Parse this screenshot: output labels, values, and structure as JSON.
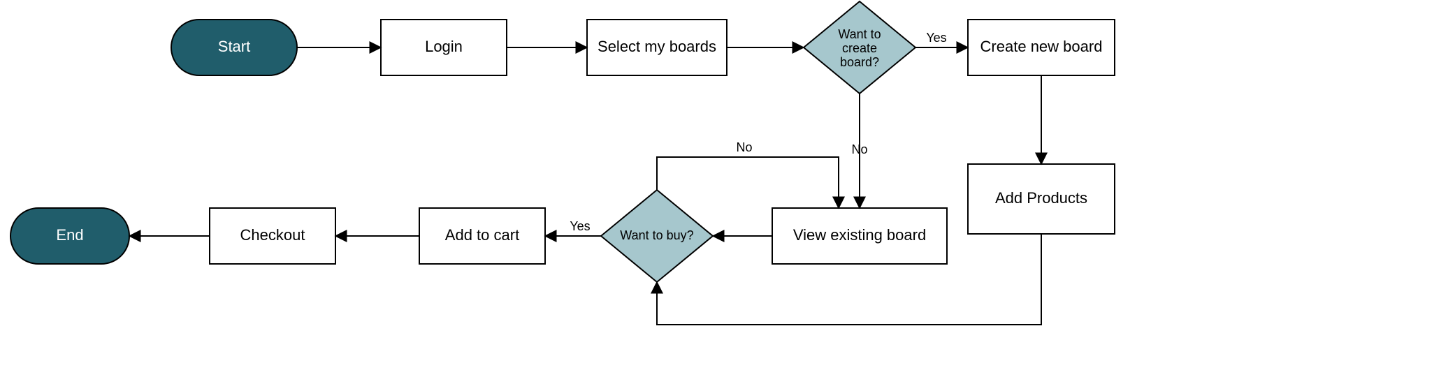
{
  "diagram": {
    "type": "flowchart",
    "nodes": {
      "start": {
        "kind": "terminator",
        "label": "Start"
      },
      "login": {
        "kind": "process",
        "label": "Login"
      },
      "select": {
        "kind": "process",
        "label": "Select my boards"
      },
      "d_create": {
        "kind": "decision",
        "label_l1": "Want to",
        "label_l2": "create",
        "label_l3": "board?"
      },
      "create": {
        "kind": "process",
        "label": "Create new board"
      },
      "addprod": {
        "kind": "process",
        "label": "Add Products"
      },
      "view": {
        "kind": "process",
        "label": "View existing board"
      },
      "d_buy": {
        "kind": "decision",
        "label": "Want to buy?"
      },
      "addcart": {
        "kind": "process",
        "label": "Add to cart"
      },
      "checkout": {
        "kind": "process",
        "label": "Checkout"
      },
      "end": {
        "kind": "terminator",
        "label": "End"
      }
    },
    "edge_labels": {
      "d_create_yes": "Yes",
      "d_create_no": "No",
      "d_buy_yes": "Yes",
      "d_buy_no": "No"
    },
    "edges": [
      {
        "from": "start",
        "to": "login"
      },
      {
        "from": "login",
        "to": "select"
      },
      {
        "from": "select",
        "to": "d_create"
      },
      {
        "from": "d_create",
        "to": "create",
        "label": "Yes"
      },
      {
        "from": "d_create",
        "to": "view",
        "label": "No"
      },
      {
        "from": "create",
        "to": "addprod"
      },
      {
        "from": "addprod",
        "to": "d_buy"
      },
      {
        "from": "view",
        "to": "d_buy"
      },
      {
        "from": "d_buy",
        "to": "addcart",
        "label": "Yes"
      },
      {
        "from": "d_buy",
        "to": "view",
        "label": "No"
      },
      {
        "from": "addcart",
        "to": "checkout"
      },
      {
        "from": "checkout",
        "to": "end"
      }
    ]
  },
  "colors": {
    "terminator_fill": "#205d6b",
    "decision_fill": "#a6c7cd",
    "process_fill": "#ffffff",
    "stroke": "#000000"
  }
}
